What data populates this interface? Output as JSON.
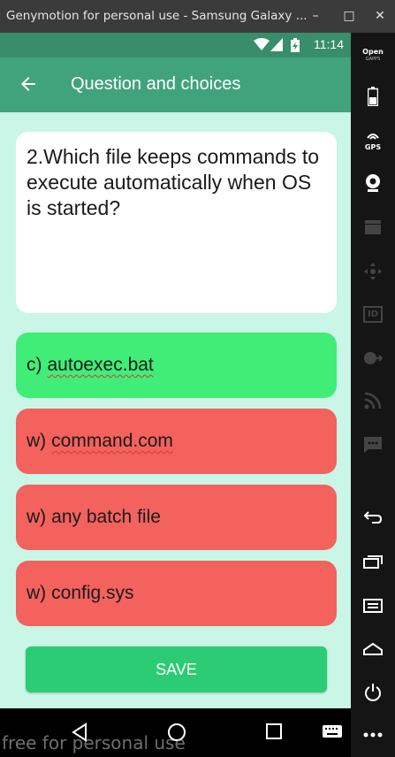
{
  "window": {
    "title": "Genymotion for personal use - Samsung Galaxy ...",
    "minimize": "–",
    "maximize": "□",
    "close": "✕"
  },
  "statusbar": {
    "time": "11:14"
  },
  "appbar": {
    "title": "Question and choices"
  },
  "question": {
    "text": "2.Which file keeps commands to execute automatically when OS is started?"
  },
  "choices": [
    {
      "prefix": "c)",
      "text": "autoexec.bat",
      "state": "correct"
    },
    {
      "prefix": "w)",
      "text": "command.com",
      "state": "wrong"
    },
    {
      "prefix": "w)",
      "text": "any batch file",
      "state": "wrong"
    },
    {
      "prefix": "w)",
      "text": "config.sys",
      "state": "wrong"
    }
  ],
  "save_label": "SAVE",
  "watermark": "free for personal use",
  "sidebar": {
    "gapps_line1": "Open",
    "gapps_line2": "GAPPS",
    "gps": "GPS",
    "id": "ID"
  },
  "colors": {
    "correct": "#40ee77",
    "wrong": "#f3625d",
    "appbar": "#41a37c",
    "background": "#c9f6e6",
    "save": "#2bcc74"
  }
}
